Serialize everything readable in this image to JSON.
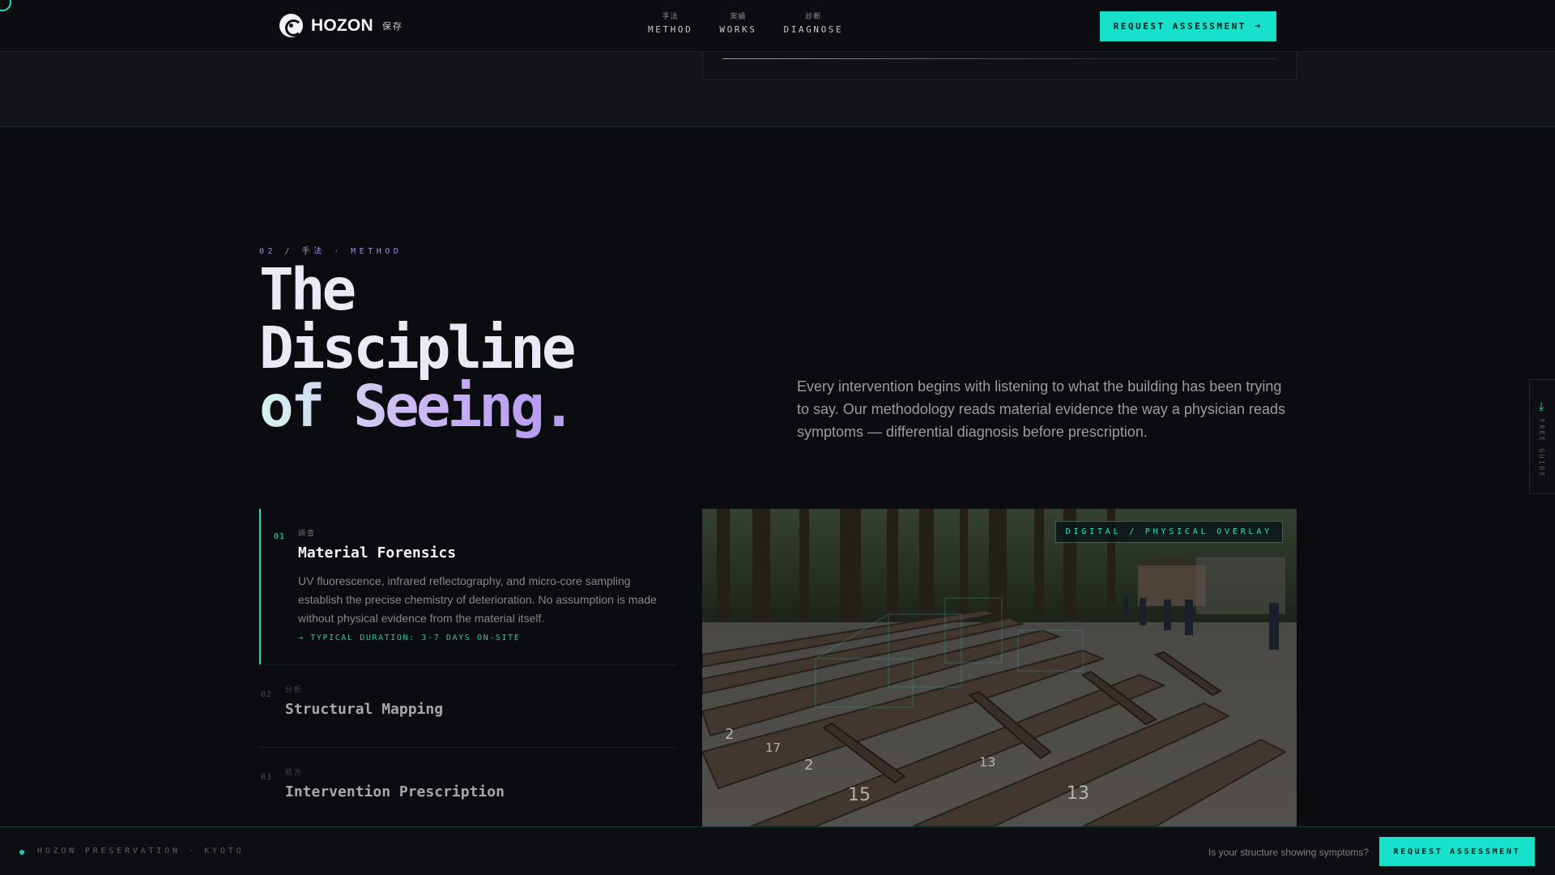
{
  "nav": {
    "brand": "HOZON",
    "brand_jp": "保存",
    "links": [
      {
        "jp": "手法",
        "label": "METHOD"
      },
      {
        "jp": "実績",
        "label": "WORKS"
      },
      {
        "jp": "診断",
        "label": "DIAGNOSE"
      }
    ],
    "cta_label": "REQUEST ASSESSMENT",
    "cta_icon": "arrow-right-icon"
  },
  "method": {
    "eyebrow": "02 / 手法 · METHOD",
    "headline_line1": "The",
    "headline_line2": "Discipline",
    "headline_line3": "of Seeing",
    "headline_dot": ".",
    "intro": "Every intervention begins with listening to what the building has been trying to say. Our methodology reads material evidence the way a physician reads symptoms — differential diagnosis before prescription.",
    "steps": [
      {
        "num": "01",
        "jp": "調査",
        "title": "Material Forensics",
        "desc": "UV fluorescence, infrared reflectography, and micro-core sampling establish the precise chemistry of deterioration. No assumption is made without physical evidence from the material itself.",
        "duration": "→ TYPICAL DURATION: 3-7 DAYS ON-SITE",
        "active": true
      },
      {
        "num": "02",
        "jp": "分析",
        "title": "Structural Mapping",
        "active": false
      },
      {
        "num": "03",
        "jp": "処方",
        "title": "Intervention Prescription",
        "active": false
      }
    ],
    "photo_badge": "DIGITAL / PHYSICAL OVERLAY",
    "photo_numbers": [
      "2",
      "17",
      "2",
      "15",
      "13",
      "13"
    ]
  },
  "side_tab": {
    "label": "FREE GUIDE",
    "icon": "download-icon"
  },
  "footer_bar": {
    "brand": "HOZON PRESERVATION · KYOTO",
    "question": "Is your structure showing symptoms?",
    "cta_label": "REQUEST ASSESSMENT"
  },
  "colors": {
    "accent": "#17e1cb",
    "eyebrow": "#a28ae6",
    "background": "#0b0c10"
  }
}
